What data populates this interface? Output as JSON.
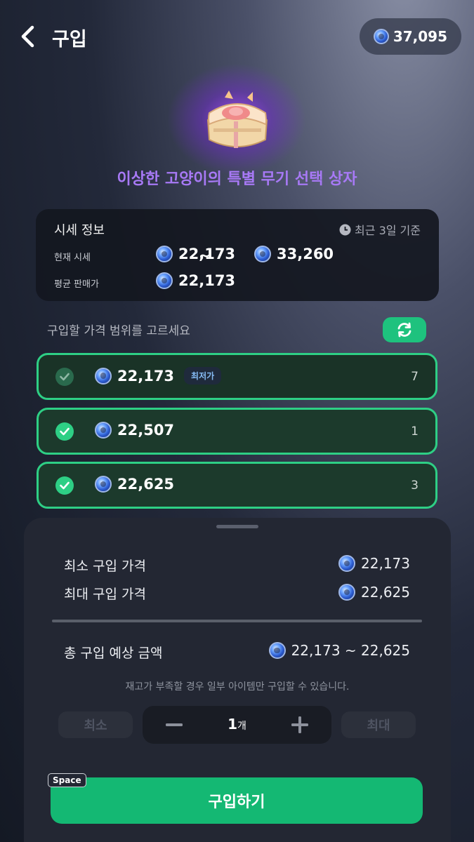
{
  "header": {
    "title": "구입",
    "balance": "37,095"
  },
  "item": {
    "name": "이상한 고양이의 특별 무기 선택 상자"
  },
  "market_info": {
    "title": "시세 정보",
    "period": "최근 3일 기준",
    "current_label": "현재 시세",
    "current_min": "22,173",
    "current_tilde": "~",
    "current_max": "33,260",
    "average_label": "평균 판매가",
    "average_value": "22,173"
  },
  "range": {
    "label": "구입할 가격 범위를 고르세요",
    "options": [
      {
        "price": "22,173",
        "badge": "최저가",
        "quantity": "7",
        "checked": true,
        "dimmed": true
      },
      {
        "price": "22,507",
        "badge": "",
        "quantity": "1",
        "checked": true,
        "dimmed": false
      },
      {
        "price": "22,625",
        "badge": "",
        "quantity": "3",
        "checked": true,
        "dimmed": false
      }
    ]
  },
  "summary": {
    "min_label": "최소 구입 가격",
    "min_value": "22,173",
    "max_label": "최대 구입 가격",
    "max_value": "22,625",
    "total_label": "총 구입 예상 금액",
    "total_value": "22,173 ~ 22,625",
    "notice": "재고가 부족할 경우 일부 아이템만 구입할 수 있습니다."
  },
  "quantity": {
    "min_label": "최소",
    "max_label": "최대",
    "value": "1",
    "unit": "개"
  },
  "buy": {
    "label": "구입하기",
    "shortcut": "Space"
  },
  "colors": {
    "accent_green": "#2ecf85",
    "button_green": "#14b873",
    "item_title_purple": "#a779f5"
  }
}
